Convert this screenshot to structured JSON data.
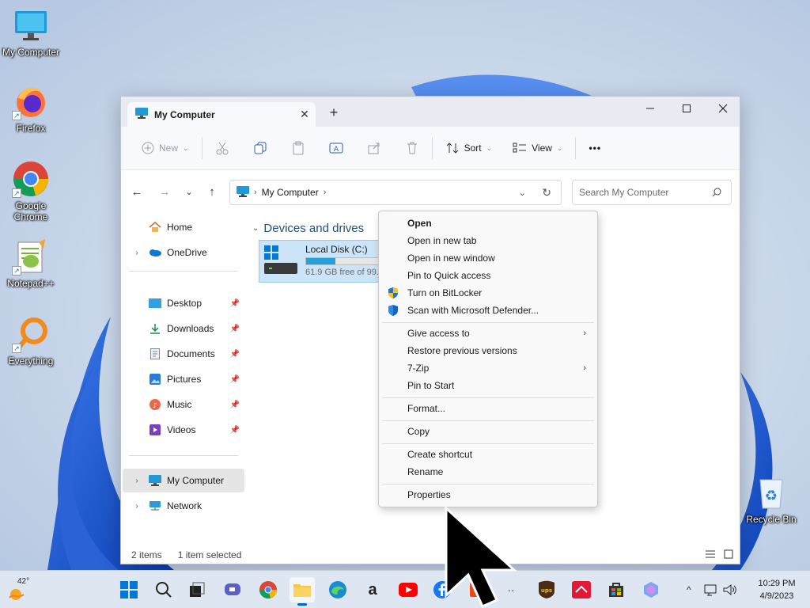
{
  "desktop": {
    "icons": [
      {
        "label": "My Computer",
        "icon": "monitor-icon"
      },
      {
        "label": "Firefox",
        "icon": "firefox-icon"
      },
      {
        "label": "Google Chrome",
        "icon": "chrome-icon"
      },
      {
        "label": "Notepad++",
        "icon": "notepadpp-icon"
      },
      {
        "label": "Everything",
        "icon": "everything-search-icon"
      },
      {
        "label": "Recycle Bin",
        "icon": "recycle-bin-icon"
      }
    ]
  },
  "window": {
    "tab_title": "My Computer",
    "tab_close": "✕",
    "new_tab": "+",
    "controls": {
      "minimize": "minimize-icon",
      "maximize": "maximize-icon",
      "close": "close-icon"
    }
  },
  "commandbar": {
    "new_label": "New",
    "sort_label": "Sort",
    "view_label": "View",
    "more_label": "•••"
  },
  "navbar": {
    "address_location": "My Computer",
    "search_placeholder": "Search My Computer"
  },
  "sidebar": {
    "top": [
      {
        "label": "Home"
      },
      {
        "label": "OneDrive"
      }
    ],
    "pinned": [
      {
        "label": "Desktop"
      },
      {
        "label": "Downloads"
      },
      {
        "label": "Documents"
      },
      {
        "label": "Pictures"
      },
      {
        "label": "Music"
      },
      {
        "label": "Videos"
      }
    ],
    "bottom": [
      {
        "label": "My Computer"
      },
      {
        "label": "Network"
      }
    ]
  },
  "content": {
    "group_title": "Devices and drives",
    "drive": {
      "name": "Local Disk (C:)",
      "free_text": "61.9 GB free of 99.",
      "used_fraction": 0.38
    }
  },
  "statusbar": {
    "items": "2 items",
    "selected": "1 item selected"
  },
  "context_menu": {
    "items": [
      {
        "label": "Open",
        "bold": true
      },
      {
        "label": "Open in new tab"
      },
      {
        "label": "Open in new window"
      },
      {
        "label": "Pin to Quick access"
      },
      {
        "label": "Turn on BitLocker",
        "icon": "shield-icon"
      },
      {
        "label": "Scan with Microsoft Defender...",
        "icon": "defender-icon"
      },
      {
        "label": "Give access to",
        "submenu": "›"
      },
      {
        "label": "Restore previous versions"
      },
      {
        "label": "7-Zip",
        "submenu": "›"
      },
      {
        "label": "Pin to Start"
      },
      {
        "label": "Format..."
      },
      {
        "label": "Copy"
      },
      {
        "label": "Create shortcut"
      },
      {
        "label": "Rename"
      },
      {
        "label": "Properties"
      }
    ]
  },
  "taskbar": {
    "weather_temp": "42°",
    "time": "10:29 PM",
    "date": "4/9/2023"
  },
  "colors": {
    "accent": "#0067c0",
    "selection": "#cce4f7",
    "taskbar": "#dde6f1"
  }
}
